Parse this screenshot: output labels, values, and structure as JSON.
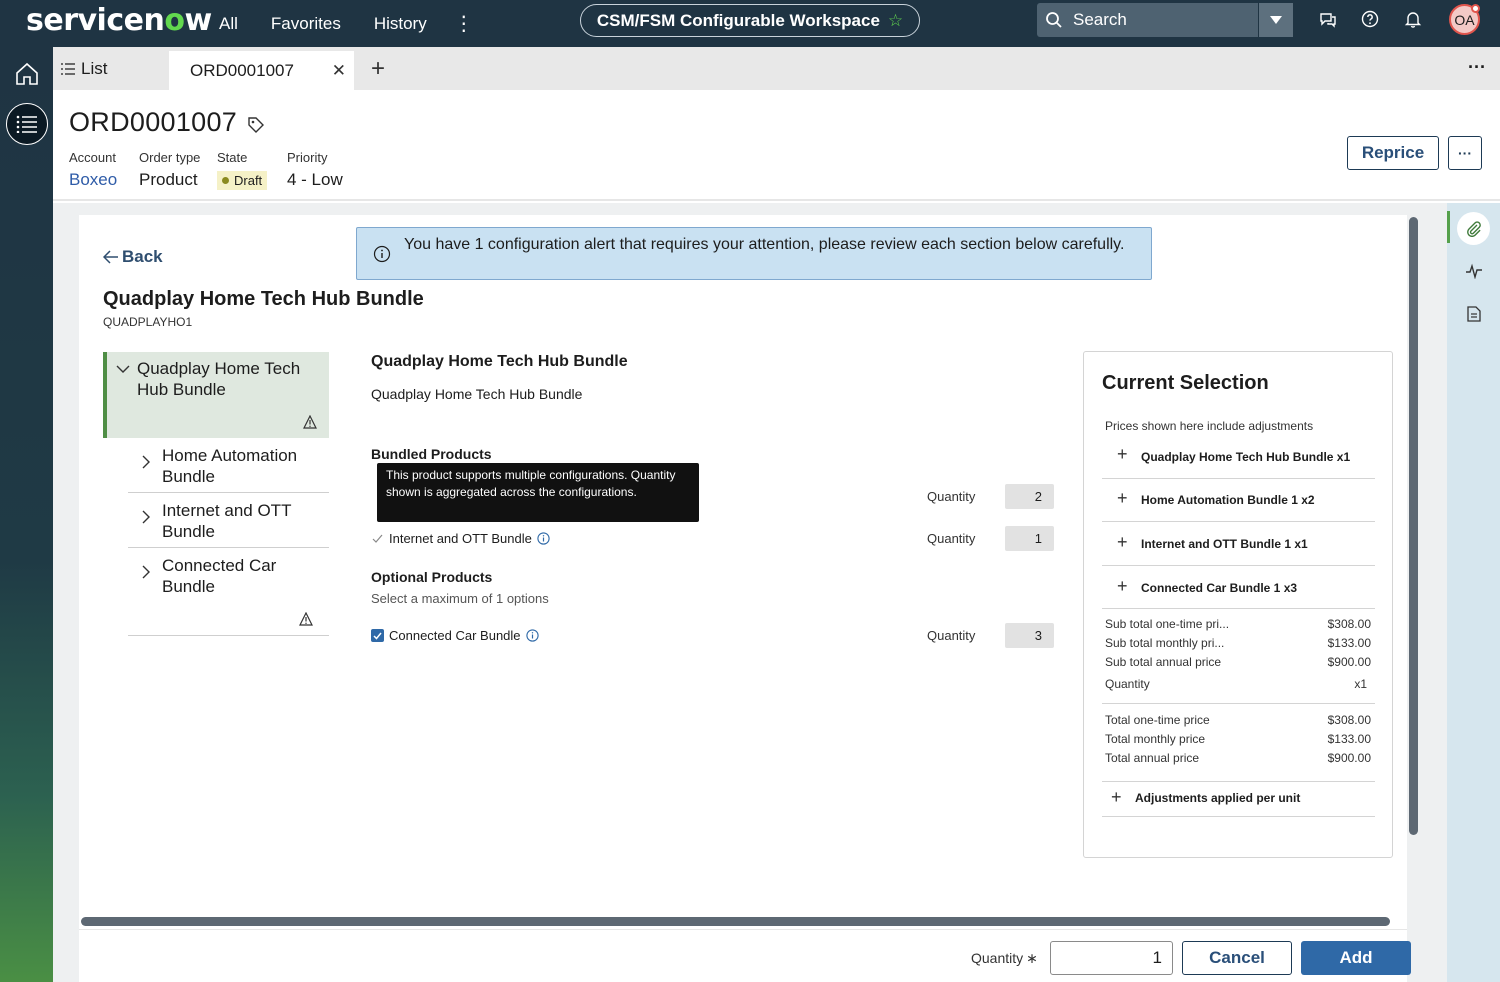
{
  "topbar": {
    "logo_text_start": "servicen",
    "logo_text_o": "o",
    "logo_text_end": "w",
    "nav": [
      "All",
      "Favorites",
      "History"
    ],
    "more_icon": "vertical-dots-icon",
    "workspace": "CSM/FSM Configurable Workspace",
    "search_placeholder": "Search",
    "avatar_initials": "OA",
    "icons": [
      "chat-icon",
      "help-icon",
      "bell-icon"
    ]
  },
  "tabs": {
    "list_label": "List",
    "active_label": "ORD0001007"
  },
  "record": {
    "title": "ORD0001007",
    "fields": [
      {
        "label": "Account",
        "value": "Boxeo"
      },
      {
        "label": "Order type",
        "value": "Product"
      },
      {
        "label": "State",
        "value": "Draft"
      },
      {
        "label": "Priority",
        "value": "4 - Low"
      }
    ],
    "reprice_label": "Reprice"
  },
  "back_label": "Back",
  "alert_text": "You have 1 configuration alert that requires your attention, please review each section below carefully.",
  "bundle": {
    "title": "Quadplay Home Tech Hub Bundle",
    "code": "QUADPLAYHO1"
  },
  "tree": {
    "root": "Quadplay Home Tech Hub Bundle",
    "children": [
      "Home Automation Bundle",
      "Internet and OTT Bundle",
      "Connected Car Bundle"
    ]
  },
  "middle": {
    "title": "Quadplay Home Tech Hub Bundle",
    "subtitle": "Quadplay Home Tech Hub Bundle",
    "bundled_title": "Bundled Products",
    "tooltip": "This product supports multiple configurations. Quantity shown is aggregated across the configurations.",
    "optional_title": "Optional Products",
    "optional_note": "Select a maximum of 1 options",
    "quantity_label": "Quantity",
    "products": [
      {
        "name": "",
        "qty": "2"
      },
      {
        "name": "Internet and OTT Bundle",
        "qty": "1"
      },
      {
        "name": "Connected Car Bundle",
        "qty": "3"
      }
    ]
  },
  "current_selection": {
    "title": "Current Selection",
    "note": "Prices shown here include adjustments",
    "items": [
      "Quadplay Home Tech Hub Bundle x1",
      "Home Automation Bundle 1 x2",
      "Internet and OTT Bundle 1 x1",
      "Connected Car Bundle 1 x3"
    ],
    "subtotals": [
      {
        "label": "Sub total one-time pri...",
        "value": "$308.00"
      },
      {
        "label": "Sub total monthly pri...",
        "value": "$133.00"
      },
      {
        "label": "Sub total annual price",
        "value": "$900.00"
      },
      {
        "label": "Quantity",
        "value": "x1"
      }
    ],
    "totals": [
      {
        "label": "Total one-time price",
        "value": "$308.00"
      },
      {
        "label": "Total monthly price",
        "value": "$133.00"
      },
      {
        "label": "Total annual price",
        "value": "$900.00"
      }
    ],
    "adjustments_label": "Adjustments applied per unit"
  },
  "footer": {
    "quantity_label": "Quantity",
    "required_mark": "∗",
    "quantity_value": "1",
    "cancel_label": "Cancel",
    "add_label": "Add"
  }
}
